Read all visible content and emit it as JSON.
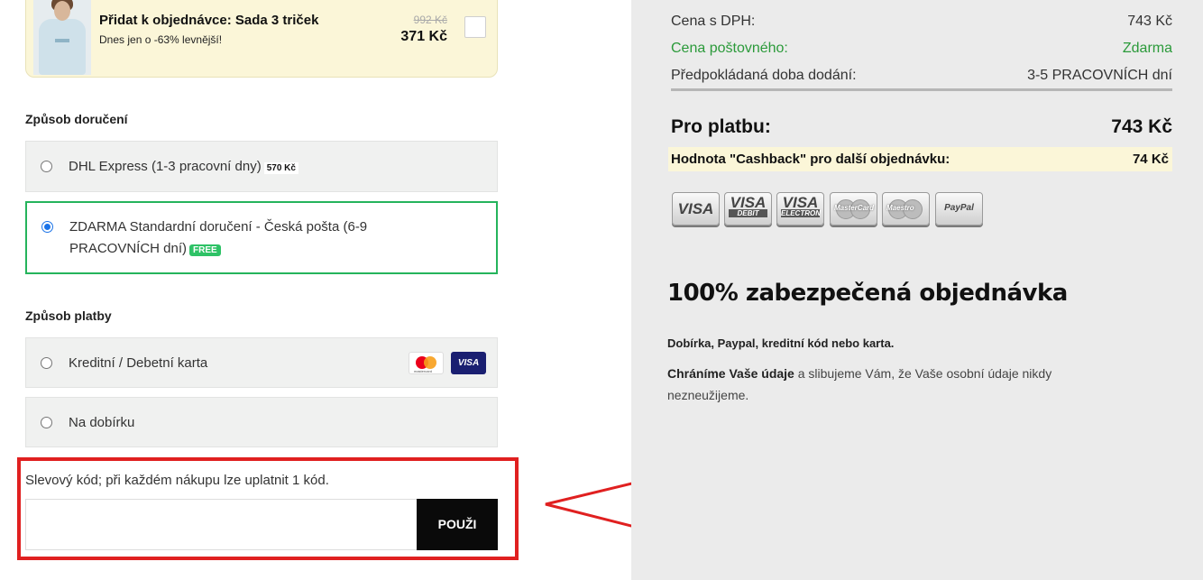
{
  "upsell": {
    "title": "Přidat k objednávce: Sada 3 triček",
    "subtitle": "Dnes jen o -63% levnější!",
    "old_price": "992 Kč",
    "new_price": "371 Kč"
  },
  "delivery": {
    "title": "Způsob doručení",
    "options": [
      {
        "label": "DHL Express (1-3 pracovní dny)",
        "tag": "570 Kč",
        "selected": false
      },
      {
        "label": "ZDARMA Standardní doručení - Česká pošta (6-9 PRACOVNÍCH dní)",
        "tag": "FREE",
        "selected": true
      }
    ]
  },
  "payment": {
    "title": "Způsob platby",
    "options": [
      {
        "label": "Kreditní / Debetní karta",
        "selected": false,
        "card_icons": [
          "mastercard-icon",
          "visa-icon"
        ]
      },
      {
        "label": "Na dobírku",
        "selected": false
      }
    ],
    "mastercard_text": "mastercard",
    "visa_text": "VISA"
  },
  "promo": {
    "label": "Slevový kód; při každém nákupu lze uplatnit 1 kód.",
    "input_value": "",
    "button_label": "POUŽI"
  },
  "summary": {
    "rows": [
      {
        "label": "Cena s DPH:",
        "value": "743 Kč"
      },
      {
        "label": "Cena poštovného:",
        "value": "Zdarma"
      },
      {
        "label": "Předpokládaná doba dodání:",
        "value": "3-5 PRACOVNÍCH dní"
      }
    ],
    "total_label": "Pro platbu:",
    "total_value": "743 Kč",
    "cashback_label": "Hodnota \"Cashback\" pro další objednávku:",
    "cashback_value": "74 Kč",
    "payment_logos": [
      {
        "name": "visa-logo",
        "text": "VISA"
      },
      {
        "name": "visa-debit-logo",
        "text": "VISA",
        "sub": "DEBIT"
      },
      {
        "name": "visa-electron-logo",
        "text": "VISA",
        "sub": "ELECTRON"
      },
      {
        "name": "mastercard-logo",
        "text": "MasterCard"
      },
      {
        "name": "maestro-logo",
        "text": "Maestro"
      },
      {
        "name": "paypal-logo",
        "text": "PayPal"
      }
    ]
  },
  "secure": {
    "title": "100% zabezpečená objednávka",
    "line1": "Dobírka, Paypal, kreditní kód nebo karta.",
    "line2_bold": "Chráníme Vaše údaje",
    "line2_rest": " a slibujeme Vám, že Vaše osobní údaje nikdy nezneužijeme."
  },
  "colors": {
    "accent_green": "#25b45c",
    "annotation_red": "#e02020",
    "cashback_bg": "#fbf6d8"
  }
}
